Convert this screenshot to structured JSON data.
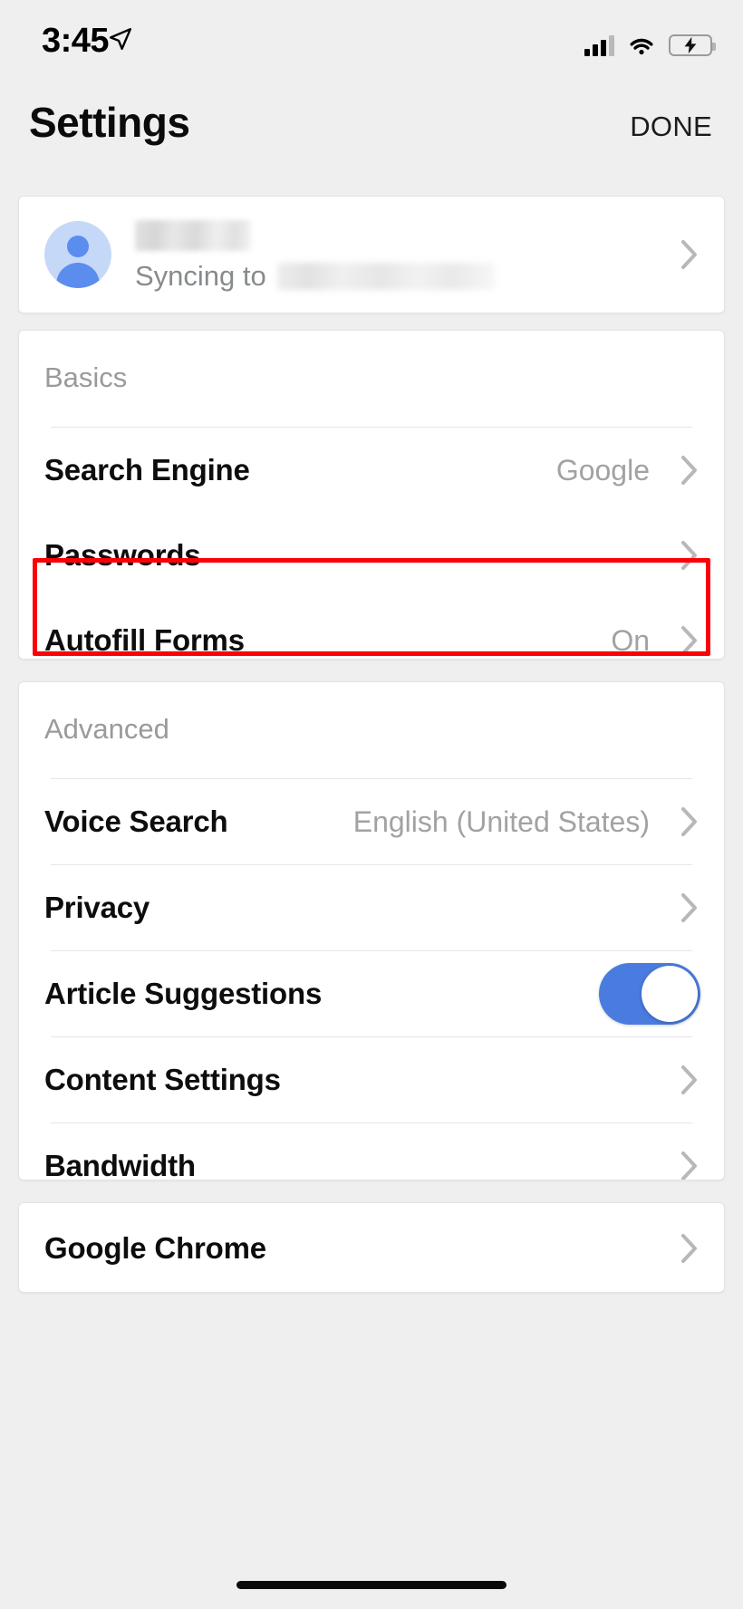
{
  "status_bar": {
    "time": "3:45",
    "location_icon": "location-arrow-icon",
    "signal_icon": "cellular-signal-icon",
    "wifi_icon": "wifi-icon",
    "battery_icon": "battery-charging-icon",
    "battery_charging": true
  },
  "header": {
    "title": "Settings",
    "done_label": "DONE"
  },
  "account": {
    "name": "",
    "sync_label": "Syncing to",
    "sync_account": "",
    "chevron": "chevron-right-icon"
  },
  "sections": [
    {
      "id": "basics",
      "title": "Basics",
      "rows": [
        {
          "label": "Search Engine",
          "value": "Google",
          "control": "chevron"
        },
        {
          "label": "Passwords",
          "value": "",
          "control": "chevron",
          "highlighted": true
        },
        {
          "label": "Autofill Forms",
          "value": "On",
          "control": "chevron"
        }
      ]
    },
    {
      "id": "advanced",
      "title": "Advanced",
      "rows": [
        {
          "label": "Voice Search",
          "value": "English (United States)",
          "control": "chevron"
        },
        {
          "label": "Privacy",
          "value": "",
          "control": "chevron"
        },
        {
          "label": "Article Suggestions",
          "value": "",
          "control": "toggle",
          "toggle_on": true
        },
        {
          "label": "Content Settings",
          "value": "",
          "control": "chevron"
        },
        {
          "label": "Bandwidth",
          "value": "",
          "control": "chevron"
        }
      ]
    },
    {
      "id": "chrome",
      "title": "",
      "rows": [
        {
          "label": "Google Chrome",
          "value": "",
          "control": "chevron"
        }
      ]
    }
  ],
  "colors": {
    "background": "#efeff0",
    "card": "#ffffff",
    "label": "#0d0d0f",
    "value": "#a2a2a4",
    "section_header": "#9a9a9c",
    "chevron": "#b8b8ba",
    "divider": "#e6e6e8",
    "toggle_on": "#4a7ce0",
    "highlight": "#fb0007",
    "avatar_bg": "#c5d8f8",
    "avatar_fg": "#5b8def",
    "battery_green": "#5fd35f"
  }
}
